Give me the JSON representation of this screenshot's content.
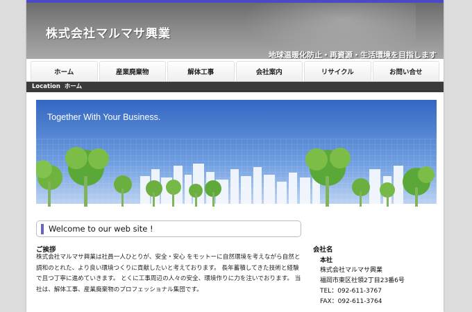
{
  "header": {
    "site_title": "株式会社マルマサ興業",
    "tagline": "地球温暖化防止・再資源・生活環境を目指します"
  },
  "nav": {
    "items": [
      "ホーム",
      "産業廃棄物",
      "解体工事",
      "会社案内",
      "リサイクル",
      "お問い合せ"
    ]
  },
  "location": {
    "label": "Location",
    "current": "ホーム"
  },
  "hero": {
    "caption": "Together With Your Business."
  },
  "welcome": {
    "title": "Welcome to our web site !"
  },
  "greeting": {
    "heading": "ご挨拶",
    "body": "株式会社マルマサ興業は社員一人ひとりが、安全・安心 をモットーに自然環境を考えながら自然と調和のとれた、より良い環境つくりに貢献したいと考えております。 長年蓄積してきた技術と経験で且つ丁寧に進めていきます。 とくに工事周辺の人々の安全、環境作りに力を注いでおります。 当社は、解体工事、産業廃棄物のプロフェッショナル集団です。"
  },
  "company": {
    "heading": "会社名",
    "office": "本社",
    "name": "株式会社マルマサ興業",
    "address": "福岡市東区社領2丁目23番6号",
    "tel": "TEL：092-611-3767",
    "fax": "FAX：092-611-3764"
  },
  "colors": {
    "topbar": "#4a4ac8",
    "sky": "#3f74c9",
    "tree": "#5aa838",
    "welcome_accent": "#6b62c6"
  }
}
